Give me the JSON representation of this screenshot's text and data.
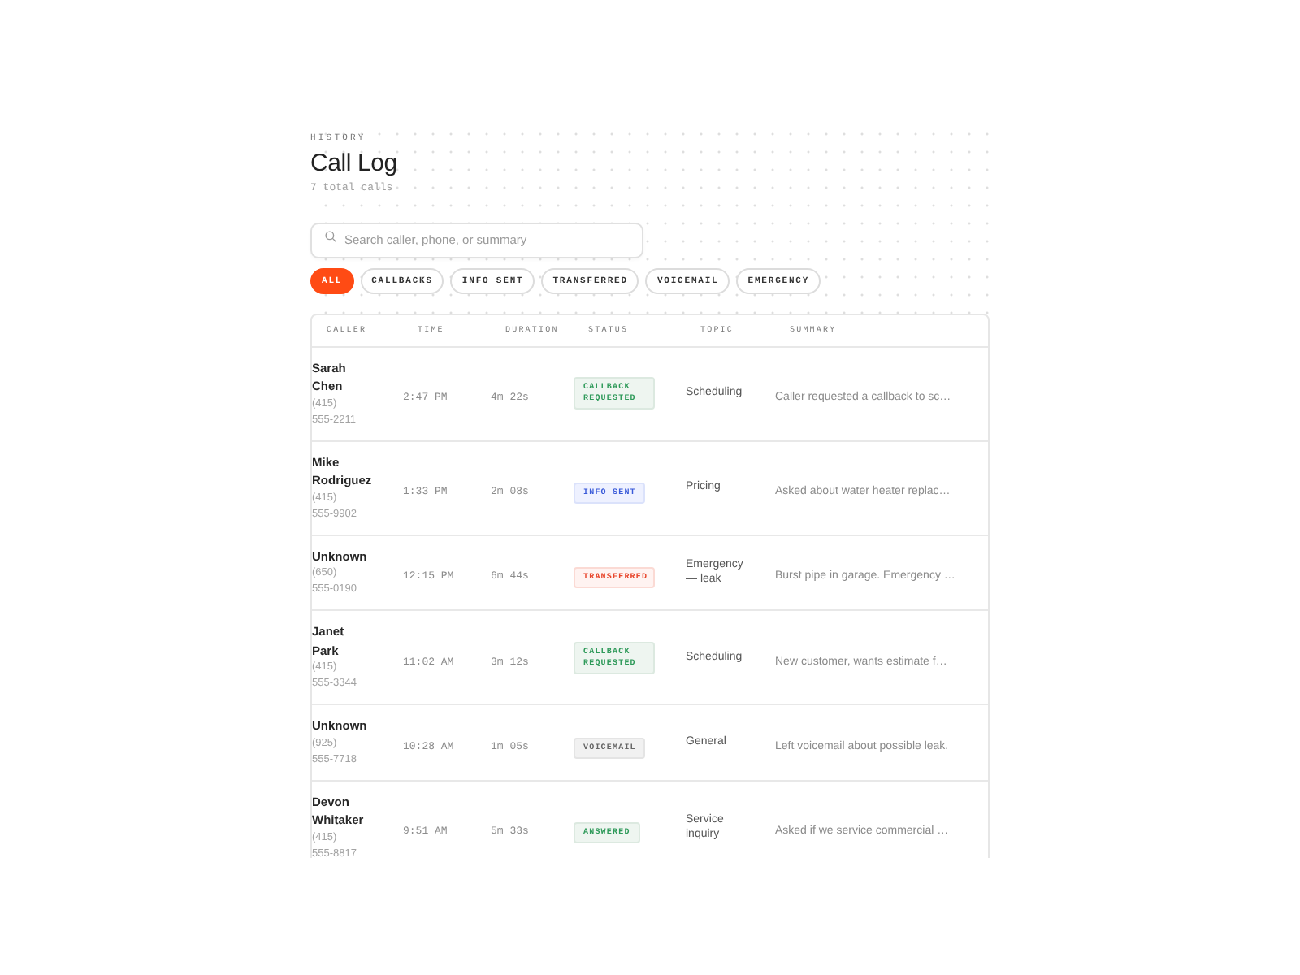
{
  "header": {
    "eyebrow": "HISTORY",
    "title": "Call Log",
    "count": "7 total calls"
  },
  "search": {
    "placeholder": "Search caller, phone, or summary"
  },
  "filters": [
    {
      "label": "ALL",
      "selected": true
    },
    {
      "label": "CALLBACKS",
      "selected": false
    },
    {
      "label": "INFO SENT",
      "selected": false
    },
    {
      "label": "TRANSFERRED",
      "selected": false
    },
    {
      "label": "VOICEMAIL",
      "selected": false
    },
    {
      "label": "EMERGENCY",
      "selected": false
    }
  ],
  "table": {
    "columns": [
      "CALLER",
      "TIME",
      "DURATION",
      "STATUS",
      "TOPIC",
      "SUMMARY"
    ],
    "rows": [
      {
        "name": "Sarah Chen",
        "phone": "(415) 555-2211",
        "time": "2:47 PM",
        "duration": "4m 22s",
        "status": {
          "label": "CALLBACK REQUESTED",
          "kind": "callback"
        },
        "topic": "Scheduling",
        "summary": "Caller requested a callback to sc…"
      },
      {
        "name": "Mike Rodriguez",
        "phone": "(415) 555-9902",
        "time": "1:33 PM",
        "duration": "2m 08s",
        "status": {
          "label": "INFO SENT",
          "kind": "info"
        },
        "topic": "Pricing",
        "summary": "Asked about water heater replac…"
      },
      {
        "name": "Unknown",
        "phone": "(650) 555-0190",
        "time": "12:15 PM",
        "duration": "6m 44s",
        "status": {
          "label": "TRANSFERRED",
          "kind": "transferred"
        },
        "topic": "Emergency — leak",
        "summary": "Burst pipe in garage. Emergency …"
      },
      {
        "name": "Janet Park",
        "phone": "(415) 555-3344",
        "time": "11:02 AM",
        "duration": "3m 12s",
        "status": {
          "label": "CALLBACK REQUESTED",
          "kind": "callback"
        },
        "topic": "Scheduling",
        "summary": "New customer, wants estimate f…"
      },
      {
        "name": "Unknown",
        "phone": "(925) 555-7718",
        "time": "10:28 AM",
        "duration": "1m 05s",
        "status": {
          "label": "VOICEMAIL",
          "kind": "voicemail"
        },
        "topic": "General",
        "summary": "Left voicemail about possible leak."
      },
      {
        "name": "Devon Whitaker",
        "phone": "(415) 555-8817",
        "time": "9:51 AM",
        "duration": "5m 33s",
        "status": {
          "label": "ANSWERED",
          "kind": "answered"
        },
        "topic": "Service inquiry",
        "summary": "Asked if we service commercial …"
      }
    ]
  }
}
